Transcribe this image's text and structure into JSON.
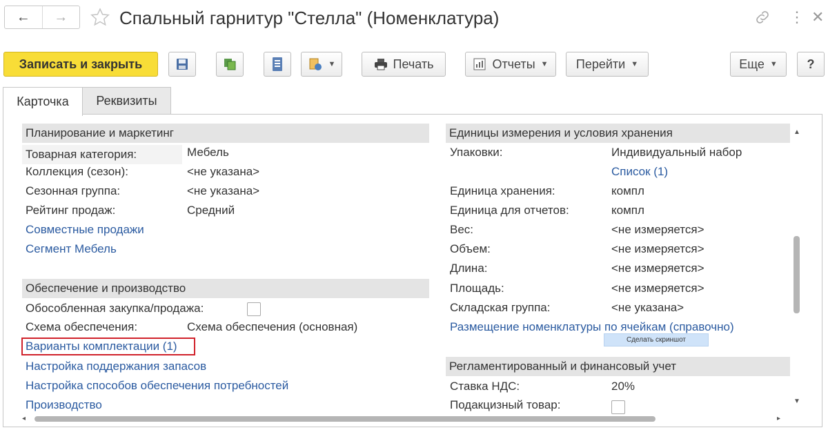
{
  "window": {
    "title": "Спальный гарнитур \"Стелла\" (Номенклатура)",
    "back_icon": "←",
    "forward_icon": "→",
    "link_icon": "link-icon",
    "more_icon": "⋮",
    "close_icon": "✕"
  },
  "toolbar": {
    "save_close_label": "Записать и закрыть",
    "print_label": "Печать",
    "reports_label": "Отчеты",
    "goto_label": "Перейти",
    "more_label": "Еще",
    "help_label": "?"
  },
  "tabs": [
    {
      "label": "Карточка",
      "active": true
    },
    {
      "label": "Реквизиты",
      "active": false
    }
  ],
  "left": {
    "planning_header": "Планирование и маркетинг",
    "fields": [
      {
        "label": "Товарная категория:",
        "value": "Мебель"
      },
      {
        "label": "Коллекция (сезон):",
        "value": "<не указана>"
      },
      {
        "label": "Сезонная группа:",
        "value": "<не указана>"
      },
      {
        "label": "Рейтинг продаж:",
        "value": "Средний"
      }
    ],
    "links1": [
      "Совместные продажи",
      "Сегмент Мебель"
    ],
    "supply_header": "Обеспечение и производство",
    "separate_purchase_label": "Обособленная закупка/продажа:",
    "supply_scheme_label": "Схема обеспечения:",
    "supply_scheme_value": "Схема обеспечения (основная)",
    "links2": [
      "Варианты комплектации (1)",
      "Настройка поддержания запасов",
      "Настройка способов обеспечения потребностей",
      "Производство"
    ]
  },
  "right": {
    "units_header": "Единицы измерения и условия хранения",
    "packages_label": "Упаковки:",
    "packages_value": "Индивидуальный набор",
    "packages_link": "Список (1)",
    "fields": [
      {
        "label": "Единица хранения:",
        "value": "компл"
      },
      {
        "label": "Единица для отчетов:",
        "value": "компл"
      },
      {
        "label": "Вес:",
        "value": "<не измеряется>"
      },
      {
        "label": "Объем:",
        "value": "<не измеряется>"
      },
      {
        "label": "Длина:",
        "value": "<не измеряется>"
      },
      {
        "label": "Площадь:",
        "value": "<не измеряется>"
      },
      {
        "label": "Складская группа:",
        "value": "<не указана>"
      }
    ],
    "placement_link": "Размещение номенклатуры по ячейкам (справочно)",
    "tax_header": "Регламентированный и финансовый учет",
    "vat_label": "Ставка НДС:",
    "vat_value": "20%",
    "excise_label": "Подакцизный товар:"
  },
  "tooltip": "Сделать скриншот",
  "colors": {
    "primary": "#f8dd37",
    "link": "#2a5aa0",
    "highlight_border": "#d0212a"
  }
}
